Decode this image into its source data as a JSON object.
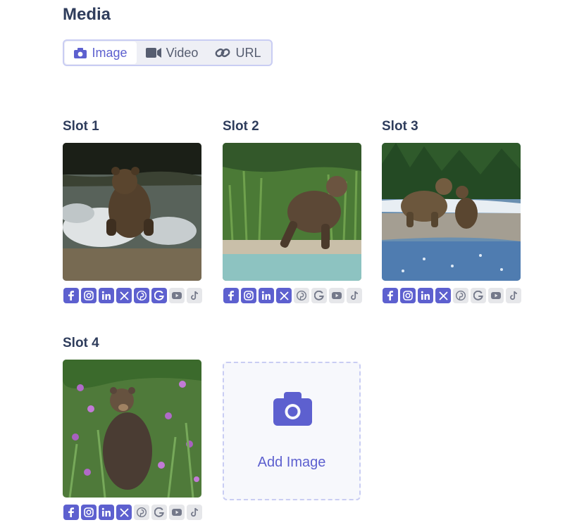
{
  "page": {
    "title": "Media"
  },
  "tabs": [
    {
      "label": "Image",
      "icon": "camera-icon",
      "active": true
    },
    {
      "label": "Video",
      "icon": "video-camera-icon",
      "active": false
    },
    {
      "label": "URL",
      "icon": "link-icon",
      "active": false
    }
  ],
  "slots": [
    {
      "label": "Slot 1",
      "image": "bear running through splashing water",
      "socials": {
        "facebook": true,
        "instagram": true,
        "linkedin": true,
        "x": true,
        "pinterest": true,
        "google": true,
        "youtube": false,
        "tiktok": false
      }
    },
    {
      "label": "Slot 2",
      "image": "bear walking along grassy riverbank",
      "socials": {
        "facebook": true,
        "instagram": true,
        "linkedin": true,
        "x": true,
        "pinterest": false,
        "google": false,
        "youtube": false,
        "tiktok": false
      }
    },
    {
      "label": "Slot 3",
      "image": "bear and cub on rocky riverbank",
      "socials": {
        "facebook": true,
        "instagram": true,
        "linkedin": true,
        "x": true,
        "pinterest": false,
        "google": false,
        "youtube": false,
        "tiktok": false
      }
    },
    {
      "label": "Slot 4",
      "image": "bear standing in wildflower meadow",
      "socials": {
        "facebook": true,
        "instagram": true,
        "linkedin": true,
        "x": true,
        "pinterest": false,
        "google": false,
        "youtube": false,
        "tiktok": false
      }
    }
  ],
  "add_slot": {
    "label": "Add Image",
    "icon": "camera-icon"
  },
  "colors": {
    "accent": "#5d60cf",
    "text": "#2f3d5c",
    "inactive": "#e6e7ea",
    "border": "#c9cdf3"
  }
}
